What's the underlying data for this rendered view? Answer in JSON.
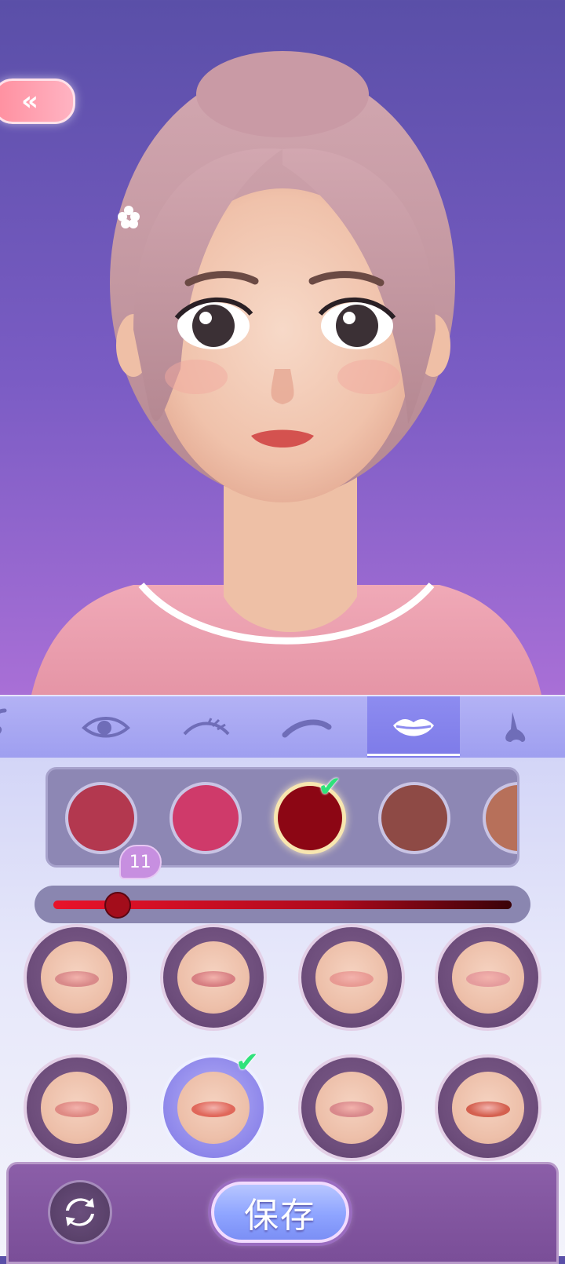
{
  "colors": {
    "accent_purple": "#7d7ae8",
    "check_green": "#2fe27a",
    "slider_start": "#e8132a",
    "slider_end": "#3a0208"
  },
  "header": {
    "back_icon": "double-chevron-left"
  },
  "tabs": [
    {
      "icon": "ear-icon",
      "active": false
    },
    {
      "icon": "eye-icon",
      "active": false
    },
    {
      "icon": "eyelash-icon",
      "active": false
    },
    {
      "icon": "eyebrow-icon",
      "active": false
    },
    {
      "icon": "lips-icon",
      "active": true
    },
    {
      "icon": "nose-icon",
      "active": false
    }
  ],
  "color_swatches": [
    {
      "color": "#b3384f",
      "selected": false
    },
    {
      "color": "#cf3a6a",
      "selected": false
    },
    {
      "color": "#8c0614",
      "selected": true
    },
    {
      "color": "#8e4a45",
      "selected": false
    },
    {
      "color": "#b7705a",
      "selected": false
    }
  ],
  "slider": {
    "value": "11",
    "fraction": 0.14
  },
  "lip_styles": [
    {
      "lip_color": "#d98a8a",
      "selected": false
    },
    {
      "lip_color": "#d77f82",
      "selected": false
    },
    {
      "lip_color": "#e89a93",
      "selected": false
    },
    {
      "lip_color": "#e59c9d",
      "selected": false
    },
    {
      "lip_color": "#df8a84",
      "selected": false
    },
    {
      "lip_color": "#e0675a",
      "selected": true
    },
    {
      "lip_color": "#d9898c",
      "selected": false
    },
    {
      "lip_color": "#d4604f",
      "selected": false
    }
  ],
  "bottom_bar": {
    "reset_icon": "refresh-arrows-icon",
    "save_label": "保存"
  }
}
